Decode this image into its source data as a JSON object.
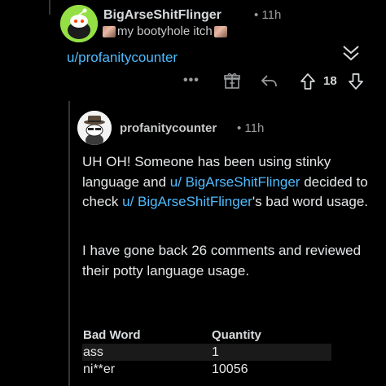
{
  "parent_comment": {
    "username": "BigArseShitFlinger",
    "time": "• 11h",
    "flair_text": "my bootyhole itch",
    "body_mention": "u/profanitycounter",
    "score": "18",
    "more_label": "•••"
  },
  "reply_comment": {
    "username": "profanitycounter",
    "time": "• 11h",
    "p1_text_a": "UH OH! Someone has been using stinky language and ",
    "p1_link_a": "u/ BigArseShitFlinger",
    "p1_text_b": " decided to check ",
    "p1_link_b": "u/ BigArseShitFlinger",
    "p1_text_c": "'s bad word usage.",
    "p2_text": "I have gone back 26 comments and reviewed their potty language usage.",
    "table": {
      "headers": [
        "Bad Word",
        "Quantity"
      ],
      "rows": [
        [
          "ass",
          "1"
        ],
        [
          "ni**er",
          "10056"
        ]
      ]
    }
  },
  "icons": {
    "collapse": "chevron-double-down-icon",
    "award": "gift-award-icon",
    "reply": "reply-arrow-icon",
    "upvote": "upvote-arrow-icon",
    "downvote": "downvote-arrow-icon"
  },
  "colors": {
    "background": "#000000",
    "link": "#4fbcff",
    "text": "#d7dadc",
    "avatar_green": "#94e044"
  }
}
